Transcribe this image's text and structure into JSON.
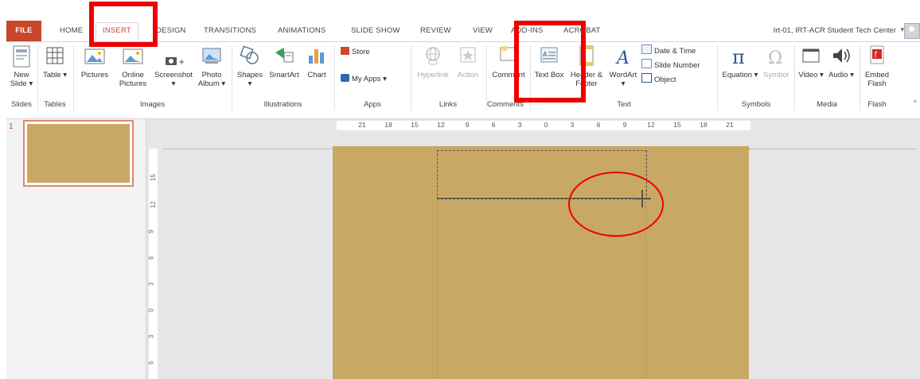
{
  "tabs": {
    "file": "FILE",
    "home": "HOME",
    "insert": "INSERT",
    "design": "DESIGN",
    "transitions": "TRANSITIONS",
    "animations": "ANIMATIONS",
    "slide_show": "SLIDE SHOW",
    "review": "REVIEW",
    "view": "VIEW",
    "add_ins": "ADD-INS",
    "acrobat": "ACROBAT"
  },
  "account": {
    "name": "Irt-01, IRT-ACR Student Tech Center",
    "caret": "▾"
  },
  "ribbon": {
    "slides": {
      "new_slide": "New Slide ▾",
      "group": "Slides"
    },
    "tables": {
      "table": "Table ▾",
      "group": "Tables"
    },
    "images": {
      "pictures": "Pictures",
      "online_pictures": "Online Pictures",
      "screenshot": "Screenshot ▾",
      "photo_album": "Photo Album ▾",
      "group": "Images"
    },
    "illustrations": {
      "shapes": "Shapes ▾",
      "smartart": "SmartArt",
      "chart": "Chart",
      "group": "Illustrations"
    },
    "apps": {
      "store": "Store",
      "my_apps": "My Apps ▾",
      "group": "Apps"
    },
    "links": {
      "hyperlink": "Hyperlink",
      "action": "Action",
      "group": "Links"
    },
    "comments": {
      "comment": "Comment",
      "group": "Comments"
    },
    "text": {
      "text_box": "Text Box",
      "header_footer": "Header & Footer",
      "wordart": "WordArt ▾",
      "date_time": "Date & Time",
      "slide_number": "Slide Number",
      "object": "Object",
      "group": "Text"
    },
    "symbols": {
      "equation": "Equation ▾",
      "symbol": "Symbol",
      "group": "Symbols"
    },
    "media": {
      "video": "Video ▾",
      "audio": "Audio ▾",
      "group": "Media"
    },
    "flash": {
      "embed_flash": "Embed Flash",
      "group": "Flash"
    }
  },
  "slide_pane": {
    "slide_number": "1"
  },
  "ruler": {
    "horizontal": [
      "21",
      "18",
      "15",
      "12",
      "9",
      "6",
      "3",
      "0",
      "3",
      "6",
      "9",
      "12",
      "15",
      "18",
      "21"
    ],
    "vertical": [
      "15",
      "12",
      "9",
      "6",
      "3",
      "0",
      "3",
      "6"
    ]
  },
  "colors": {
    "accent": "#c8472c",
    "slide_background": "#c8a864",
    "annotation": "#ee0000"
  }
}
